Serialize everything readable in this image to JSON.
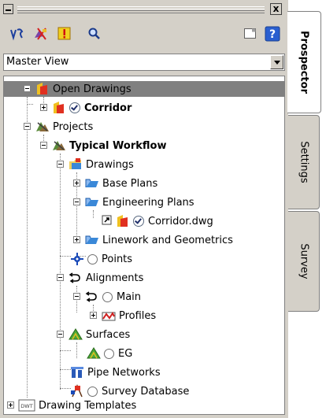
{
  "window": {
    "minimize_glyph": "",
    "close_glyph": "x"
  },
  "toolbar": {
    "buttons": [
      {
        "name": "prospector-data-icon"
      },
      {
        "name": "surface-tools-icon"
      },
      {
        "name": "warning-icon"
      },
      {
        "name": "search-icon"
      },
      {
        "name": "panel-icon"
      },
      {
        "name": "help-icon",
        "label": "?"
      }
    ]
  },
  "view_selector": {
    "selected": "Master View"
  },
  "tree": {
    "open_drawings": "Open Drawings",
    "corridor": "Corridor",
    "projects": "Projects",
    "typical_workflow": "Typical Workflow",
    "drawings": "Drawings",
    "base_plans": "Base Plans",
    "engineering_plans": "Engineering Plans",
    "corridor_dwg": "Corridor.dwg",
    "linework": "Linework and Geometrics",
    "points": "Points",
    "alignments": "Alignments",
    "main": "Main",
    "profiles": "Profiles",
    "surfaces": "Surfaces",
    "eg": "EG",
    "pipe_networks": "Pipe Networks",
    "survey_database": "Survey Database",
    "drawing_templates": "Drawing Templates",
    "dwt_badge": "DWT"
  },
  "tabs": {
    "prospector": "Prospector",
    "settings": "Settings",
    "survey": "Survey"
  },
  "colors": {
    "selection": "#808080",
    "chrome": "#d4d0c8"
  }
}
